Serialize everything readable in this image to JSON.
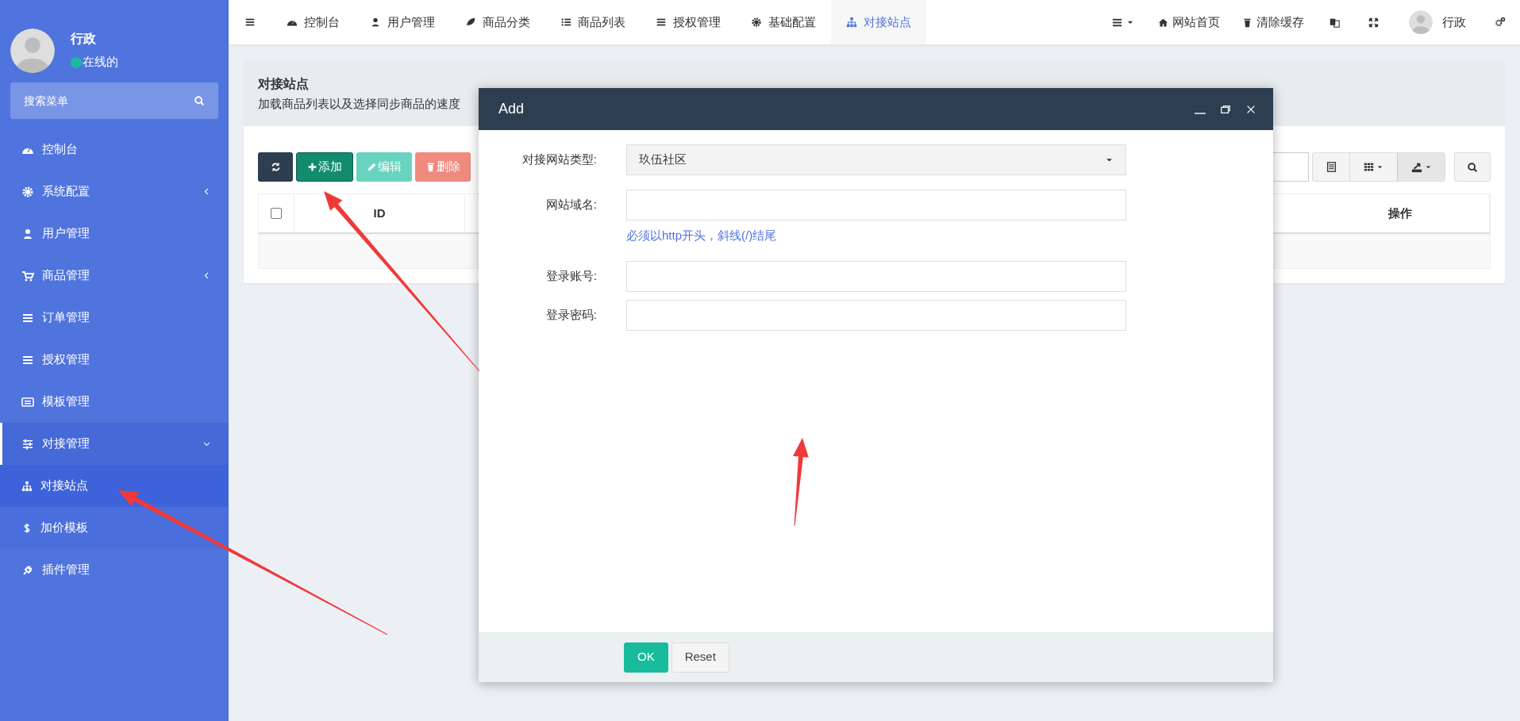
{
  "sidebar": {
    "user": {
      "name": "行政",
      "status": "在线的"
    },
    "search": {
      "placeholder": "搜索菜单"
    },
    "menu": [
      {
        "label": "控制台",
        "selected": false
      },
      {
        "label": "系统配置",
        "selected": false,
        "expanded": false
      },
      {
        "label": "用户管理",
        "selected": false
      },
      {
        "label": "商品管理",
        "selected": false,
        "expanded": false
      },
      {
        "label": "订单管理",
        "selected": false
      },
      {
        "label": "授权管理",
        "selected": false
      },
      {
        "label": "模板管理",
        "selected": false
      },
      {
        "label": "对接管理",
        "selected": true,
        "expanded": true,
        "children": [
          {
            "label": "对接站点",
            "selected": true
          },
          {
            "label": "加价模板",
            "selected": false
          }
        ]
      },
      {
        "label": "插件管理",
        "selected": false
      }
    ]
  },
  "top_nav": {
    "tabs": [
      {
        "label": "控制台",
        "selected": false
      },
      {
        "label": "用户管理",
        "selected": false
      },
      {
        "label": "商品分类",
        "selected": false
      },
      {
        "label": "商品列表",
        "selected": false
      },
      {
        "label": "授权管理",
        "selected": false
      },
      {
        "label": "基础配置",
        "selected": false
      },
      {
        "label": "对接站点",
        "selected": true
      }
    ],
    "links": [
      "网站首页",
      "清除缓存"
    ],
    "user": "行政"
  },
  "panel": {
    "title": "对接站点",
    "description": "加载商品列表以及选择同步商品的速度",
    "toolbar": [
      {
        "kind": "refresh",
        "disabled": false
      },
      {
        "kind": "add",
        "label": "添加",
        "disabled": false
      },
      {
        "kind": "edit",
        "label": "编辑",
        "disabled": true
      },
      {
        "kind": "delete",
        "label": "删除",
        "disabled": true
      }
    ],
    "table": {
      "select_all": {
        "checked": false
      },
      "columns": [
        "ID",
        "操作"
      ]
    }
  },
  "dialog": {
    "title": "Add",
    "fields": [
      {
        "kind": "select",
        "label": "对接网站类型:",
        "value": "玖伍社区"
      },
      {
        "kind": "text",
        "label": "网站域名:",
        "help": "必须以http开头，斜线(/)结尾"
      },
      {
        "kind": "text",
        "label": "登录账号:"
      },
      {
        "kind": "password",
        "label": "登录密码:"
      }
    ],
    "buttons": [
      {
        "kind": "primary",
        "label": "OK"
      },
      {
        "kind": "default",
        "label": "Reset"
      }
    ]
  }
}
